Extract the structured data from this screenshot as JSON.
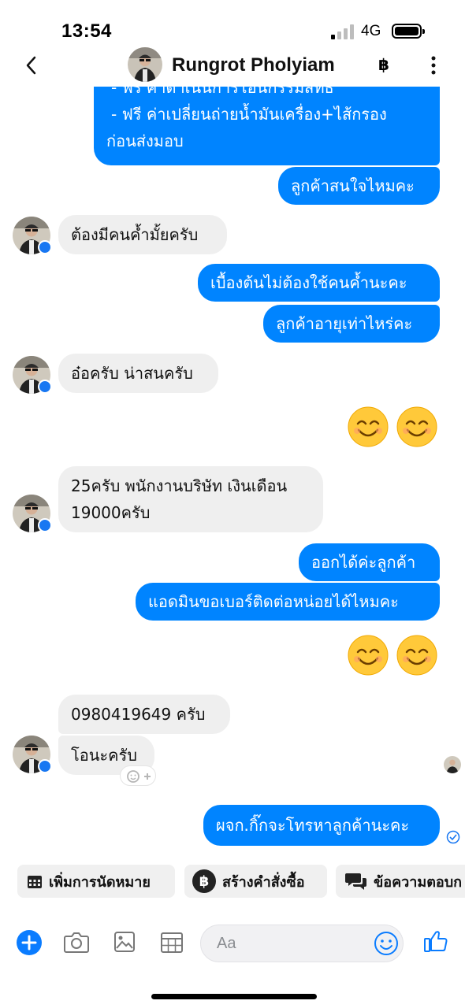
{
  "status_bar": {
    "time": "13:54",
    "network": "4G"
  },
  "header": {
    "contact_name": "Rungrot Pholyiam",
    "currency_icon": "฿"
  },
  "messages": {
    "m1_line1": "- ฟรี ค่าดำเนินการโอนกรรมสิทธิ์",
    "m1_line2": "- ฟรี ค่าเปลี่ยนถ่ายน้ำมันเครื่อง+ไส้กรอง",
    "m1_line3": "ก่อนส่งมอบ",
    "m2": "ลูกค้าสนใจไหมคะ",
    "m3": "ต้องมีคนค้ำมั้ยครับ",
    "m4": "เบื้องต้นไม่ต้องใช้คนค้ำนะคะ",
    "m5": "ลูกค้าอายุเท่าไหร่คะ",
    "m6": "อ๋อครับ น่าสนครับ",
    "m7_line1": "25ครับ พนักงานบริษัท เงินเดือน",
    "m7_line2": "19000ครับ",
    "m8": "ออกได้ค่ะลูกค้า",
    "m9": "แอดมินขอเบอร์ติดต่อหน่อยได้ไหมคะ",
    "m10": "0980419649 ครับ",
    "m11": "โอนะครับ",
    "m12": "ผจก.กิ๊กจะโทรหาลูกค้านะคะ"
  },
  "quick_actions": [
    {
      "label": "เพิ่มการนัดหมาย",
      "icon": "calendar-icon"
    },
    {
      "label": "สร้างคำสั่งซื้อ",
      "icon": "baht-icon"
    },
    {
      "label": "ข้อความตอบก",
      "icon": "chat-bubbles-icon"
    }
  ],
  "composer": {
    "placeholder": "Aa"
  },
  "colors": {
    "outgoing": "#0084ff",
    "incoming": "#efefef",
    "accent": "#1877f2"
  }
}
